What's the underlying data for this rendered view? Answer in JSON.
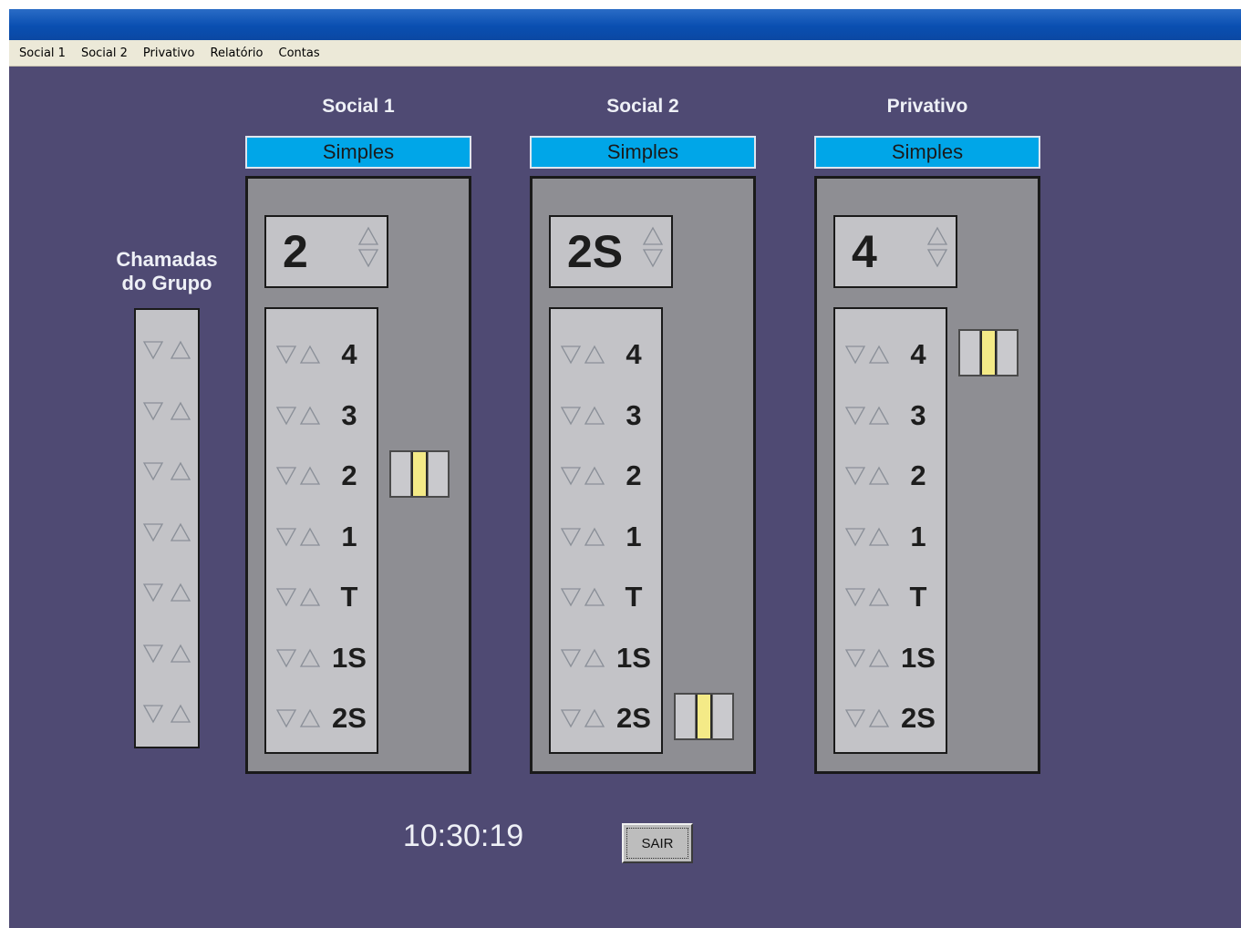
{
  "menu": {
    "items": [
      "Social 1",
      "Social 2",
      "Privativo",
      "Relatório",
      "Contas"
    ]
  },
  "group": {
    "title_line1": "Chamadas",
    "title_line2": "do Grupo",
    "rows": 7
  },
  "floors": [
    "4",
    "3",
    "2",
    "1",
    "T",
    "1S",
    "2S"
  ],
  "elevators": [
    {
      "title": "Social 1",
      "mode": "Simples",
      "current_floor": "2",
      "car_floor": "2"
    },
    {
      "title": "Social 2",
      "mode": "Simples",
      "current_floor": "2S",
      "car_floor": "2S"
    },
    {
      "title": "Privativo",
      "mode": "Simples",
      "current_floor": "4",
      "car_floor": "4"
    }
  ],
  "clock": "10:30:19",
  "exit_button": {
    "label": "SAIR"
  },
  "colors": {
    "background": "#4f4a73",
    "mode_bar": "#00a6e8",
    "panel": "#c3c3c7",
    "shaft": "#8e8e93",
    "car_door": "#f4ea87"
  },
  "icons": {
    "call_up": "triangle-up-outline",
    "call_down": "triangle-down-outline"
  }
}
